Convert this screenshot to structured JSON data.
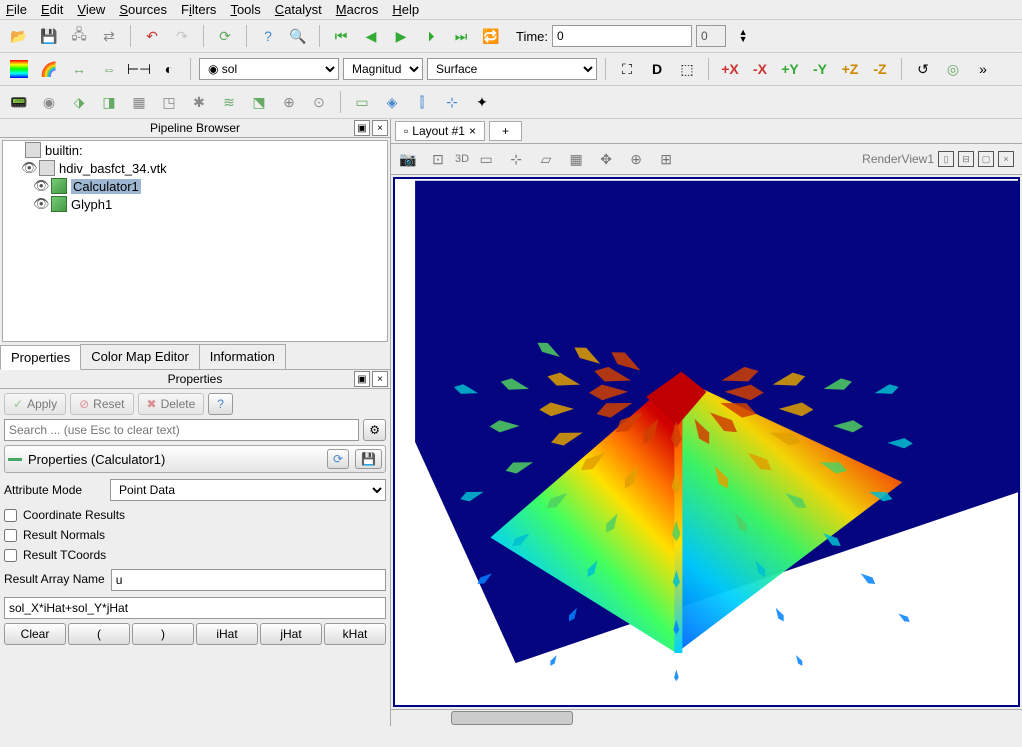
{
  "menubar": [
    "File",
    "Edit",
    "View",
    "Sources",
    "Filters",
    "Tools",
    "Catalyst",
    "Macros",
    "Help"
  ],
  "toolbar1": {
    "time_label": "Time:",
    "time_value": "0",
    "frame_value": "0"
  },
  "toolbar2": {
    "array": "sol",
    "component": "Magnitude",
    "representation": "Surface"
  },
  "pipeline": {
    "title": "Pipeline Browser",
    "root": "builtin:",
    "items": [
      {
        "name": "hdiv_basfct_34.vtk",
        "icon": "file",
        "visible": true
      },
      {
        "name": "Calculator1",
        "icon": "cube",
        "visible": true,
        "selected": true
      },
      {
        "name": "Glyph1",
        "icon": "cube",
        "visible": true
      }
    ]
  },
  "tabs": {
    "properties": "Properties",
    "colormap": "Color Map Editor",
    "info": "Information"
  },
  "properties": {
    "title": "Properties",
    "apply": "Apply",
    "reset": "Reset",
    "delete": "Delete",
    "help": "?",
    "search_placeholder": "Search ... (use Esc to clear text)",
    "section": "Properties (Calculator1)",
    "attr_mode_label": "Attribute Mode",
    "attr_mode_value": "Point Data",
    "coord_results": "Coordinate Results",
    "result_normals": "Result Normals",
    "result_tcoords": "Result TCoords",
    "result_array_label": "Result Array Name",
    "result_array_value": "u",
    "expression": "sol_X*iHat+sol_Y*jHat",
    "calc_buttons": [
      "Clear",
      "(",
      ")",
      "iHat",
      "jHat",
      "kHat"
    ]
  },
  "layout": {
    "tab": "Layout #1",
    "plus": "+",
    "view": "RenderView1"
  },
  "mini_tb": [
    "3D"
  ],
  "chart_data": {
    "type": "vector-glyph-3d",
    "description": "3D warped triangular surface colored by magnitude (rainbow) with planar dark-blue background mesh and arrow glyphs pointing outward from peak",
    "color_scale": "blue-cyan-green-yellow-red",
    "peak_position": "upper-right of triangle",
    "background_plane_color": "#05057f"
  }
}
